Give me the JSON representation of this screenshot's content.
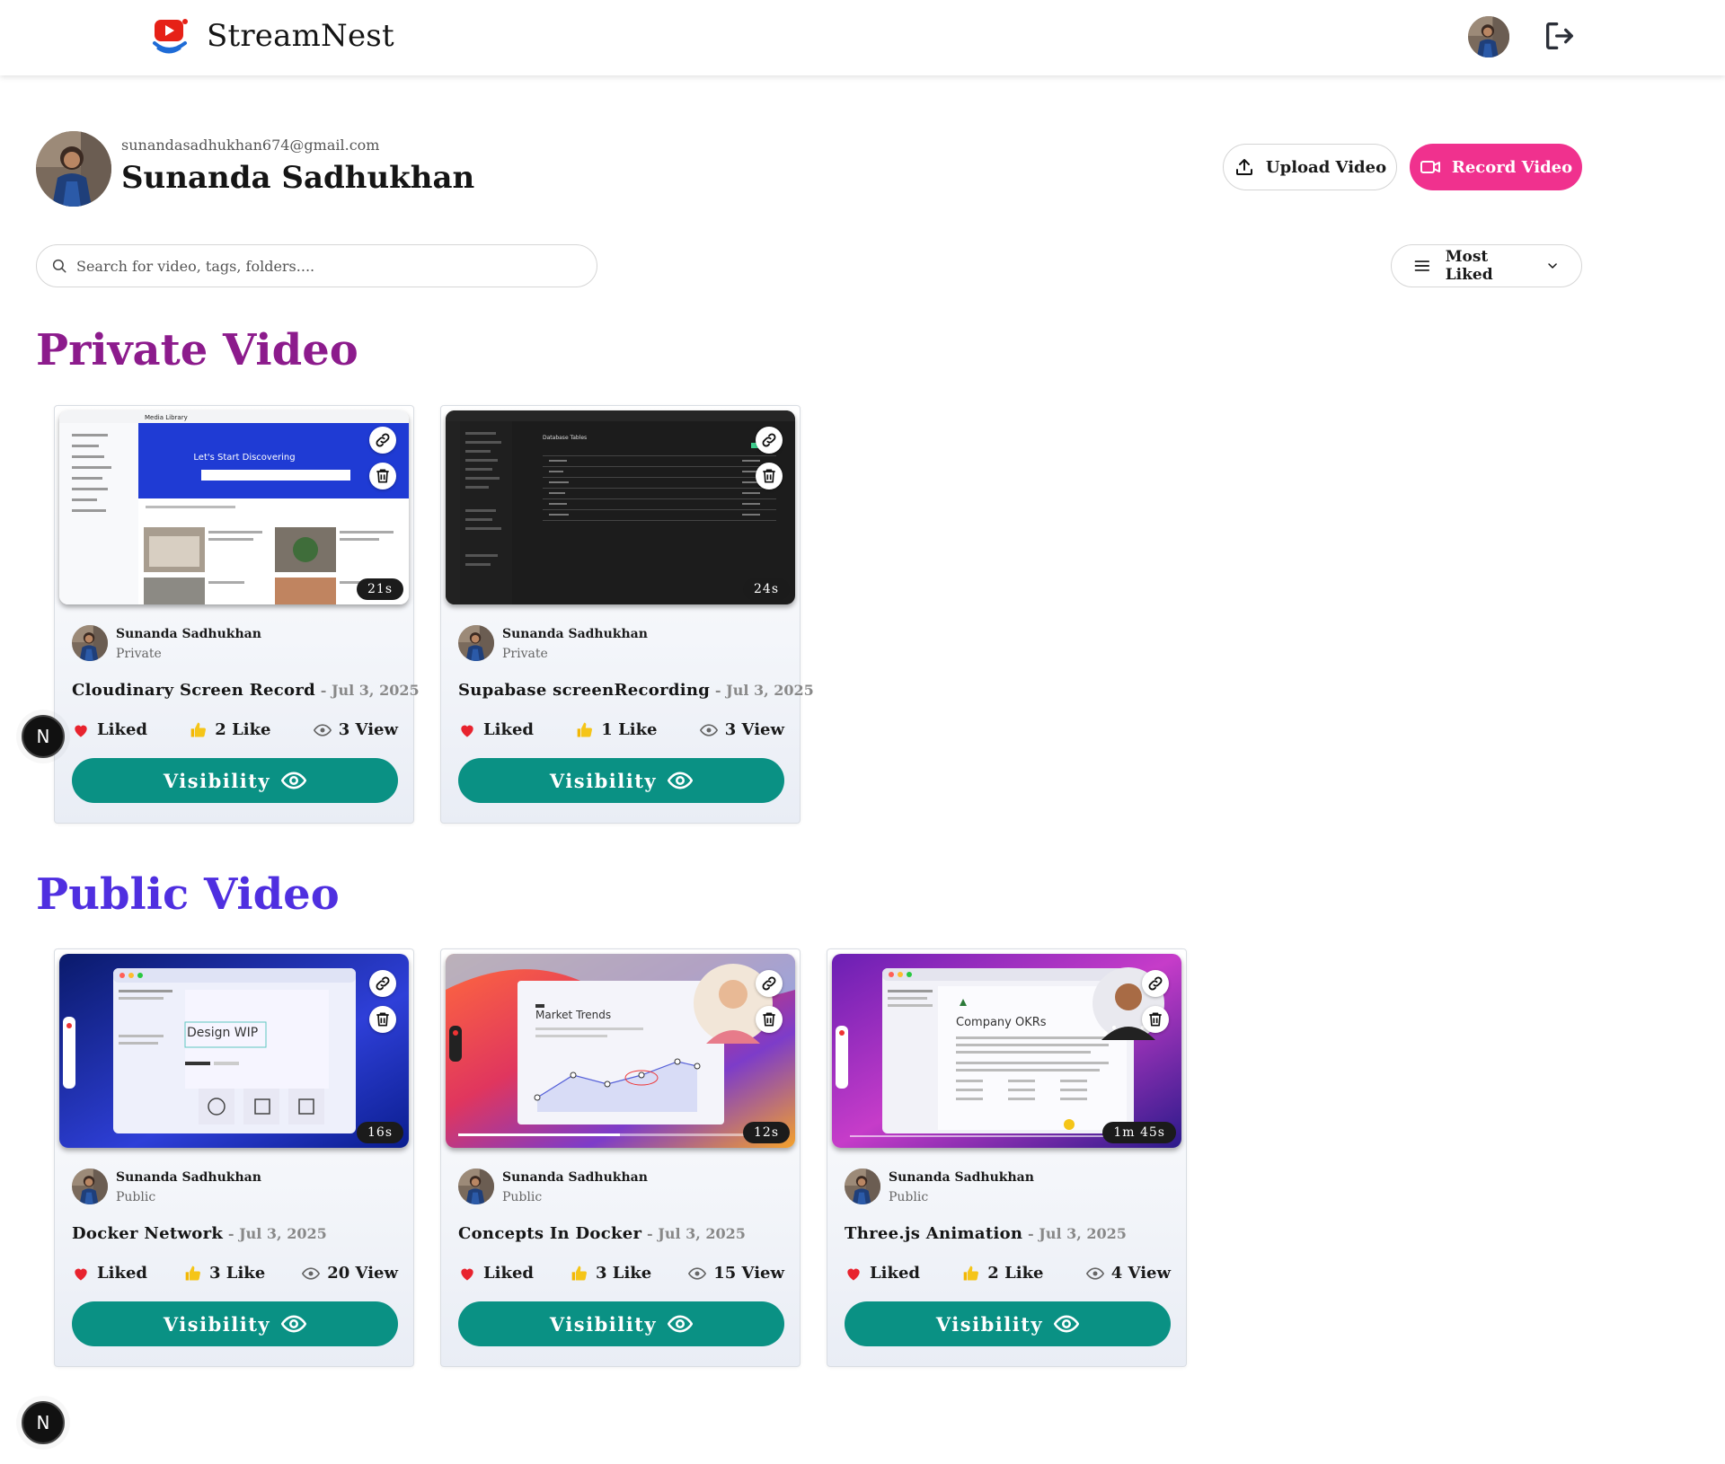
{
  "app": {
    "name": "StreamNest"
  },
  "profile": {
    "email": "sunandasadhukhan674@gmail.com",
    "name": "Sunanda Sadhukhan"
  },
  "actions": {
    "upload_label": "Upload Video",
    "record_label": "Record Video"
  },
  "search": {
    "placeholder": "Search for video, tags, folders...."
  },
  "sort": {
    "selected": "Most Liked"
  },
  "sections": {
    "private_title": "Private Video",
    "public_title": "Public Video"
  },
  "private_videos": [
    {
      "owner": "Sunanda Sadhukhan",
      "visibility": "Private",
      "title": "Cloudinary Screen Record",
      "date": "- Jul 3, 2025",
      "duration": "21s",
      "liked_label": "Liked",
      "likes": "2 Like",
      "views": "3 View",
      "button": "Visibility",
      "thumb": {
        "banner_title": "Let's Start Discovering",
        "app": "Media Library"
      }
    },
    {
      "owner": "Sunanda Sadhukhan",
      "visibility": "Private",
      "title": "Supabase screenRecording",
      "date": "- Jul 3, 2025",
      "duration": "24s",
      "liked_label": "Liked",
      "likes": "1 Like",
      "views": "3 View",
      "button": "Visibility",
      "thumb": {
        "panel_title": "Database Tables"
      }
    }
  ],
  "public_videos": [
    {
      "owner": "Sunanda Sadhukhan",
      "visibility": "Public",
      "title": "Docker Network",
      "date": "- Jul 3, 2025",
      "duration": "16s",
      "liked_label": "Liked",
      "likes": "3 Like",
      "views": "20 View",
      "button": "Visibility",
      "thumb": {
        "label": "Design WIP"
      }
    },
    {
      "owner": "Sunanda Sadhukhan",
      "visibility": "Public",
      "title": "Concepts In Docker",
      "date": "- Jul 3, 2025",
      "duration": "12s",
      "liked_label": "Liked",
      "likes": "3 Like",
      "views": "15 View",
      "button": "Visibility",
      "thumb": {
        "label": "Market Trends"
      }
    },
    {
      "owner": "Sunanda Sadhukhan",
      "visibility": "Public",
      "title": "Three.js Animation",
      "date": "- Jul 3, 2025",
      "duration": "1m 45s",
      "liked_label": "Liked",
      "likes": "2 Like",
      "views": "4 View",
      "button": "Visibility",
      "thumb": {
        "label": "Company OKRs"
      }
    }
  ],
  "dev_badge": {
    "letter": "N"
  },
  "colors": {
    "brand_pink": "#f0318e",
    "teal": "#0a9184",
    "private_heading": "#8c1b8c",
    "public_heading": "#4f2fe0",
    "heart": "#e8232e",
    "thumb": "#f5c518"
  }
}
